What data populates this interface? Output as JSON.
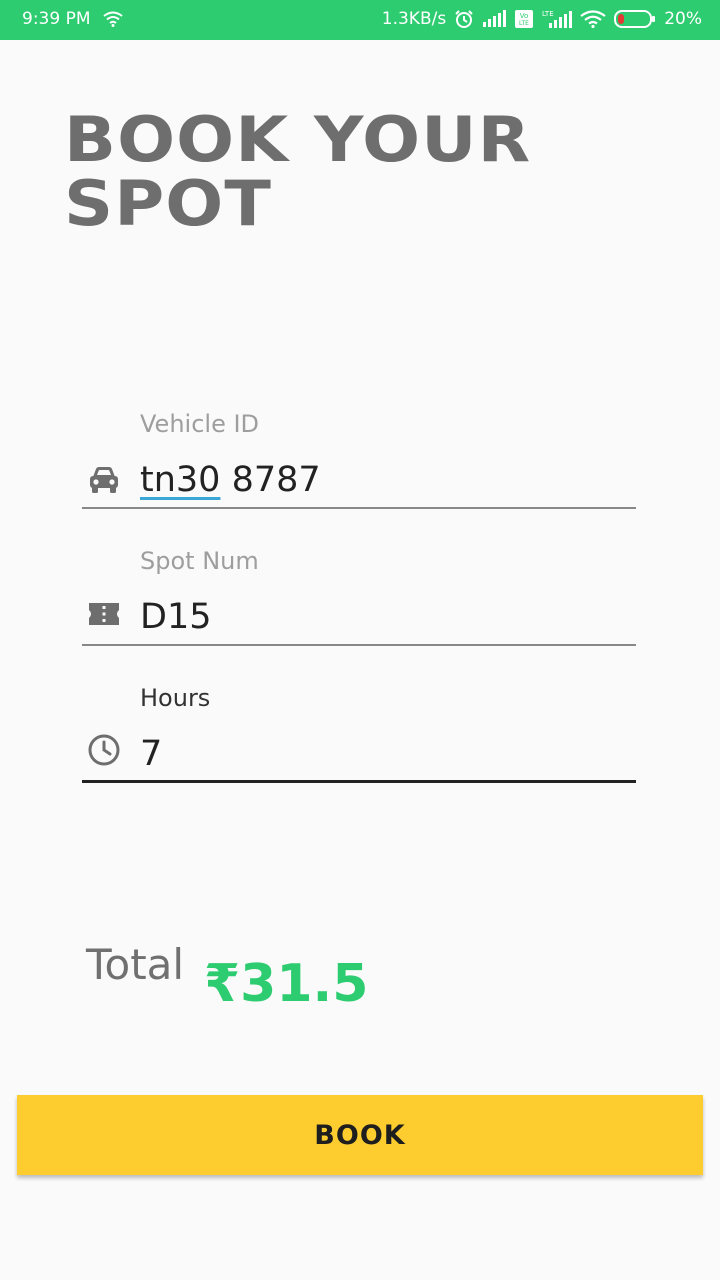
{
  "status_bar": {
    "time": "9:39 PM",
    "network_speed": "1.3KB/s",
    "battery_percent": "20%",
    "volte_badge": "Vo LTE",
    "lte_badge": "LTE",
    "icons": [
      "wifi-icon",
      "alarm-icon",
      "signal-icon",
      "volte-icon",
      "lte-signal-icon",
      "wifi-icon",
      "battery-icon"
    ],
    "background_color": "#2ecc71"
  },
  "header": {
    "title": "BOOK YOUR SPOT"
  },
  "form": {
    "vehicle": {
      "label": "Vehicle ID",
      "value_part1": "tn30",
      "value_part2": " 8787",
      "icon": "car-icon"
    },
    "spot": {
      "label": "Spot Num",
      "value": "D15",
      "icon": "ticket-icon"
    },
    "hours": {
      "label": "Hours",
      "value": "7",
      "icon": "clock-icon"
    }
  },
  "total": {
    "label": "Total",
    "amount": "₹31.5",
    "color": "#2ecc71"
  },
  "actions": {
    "book_label": "BOOK",
    "button_color": "#fdcd2f"
  }
}
